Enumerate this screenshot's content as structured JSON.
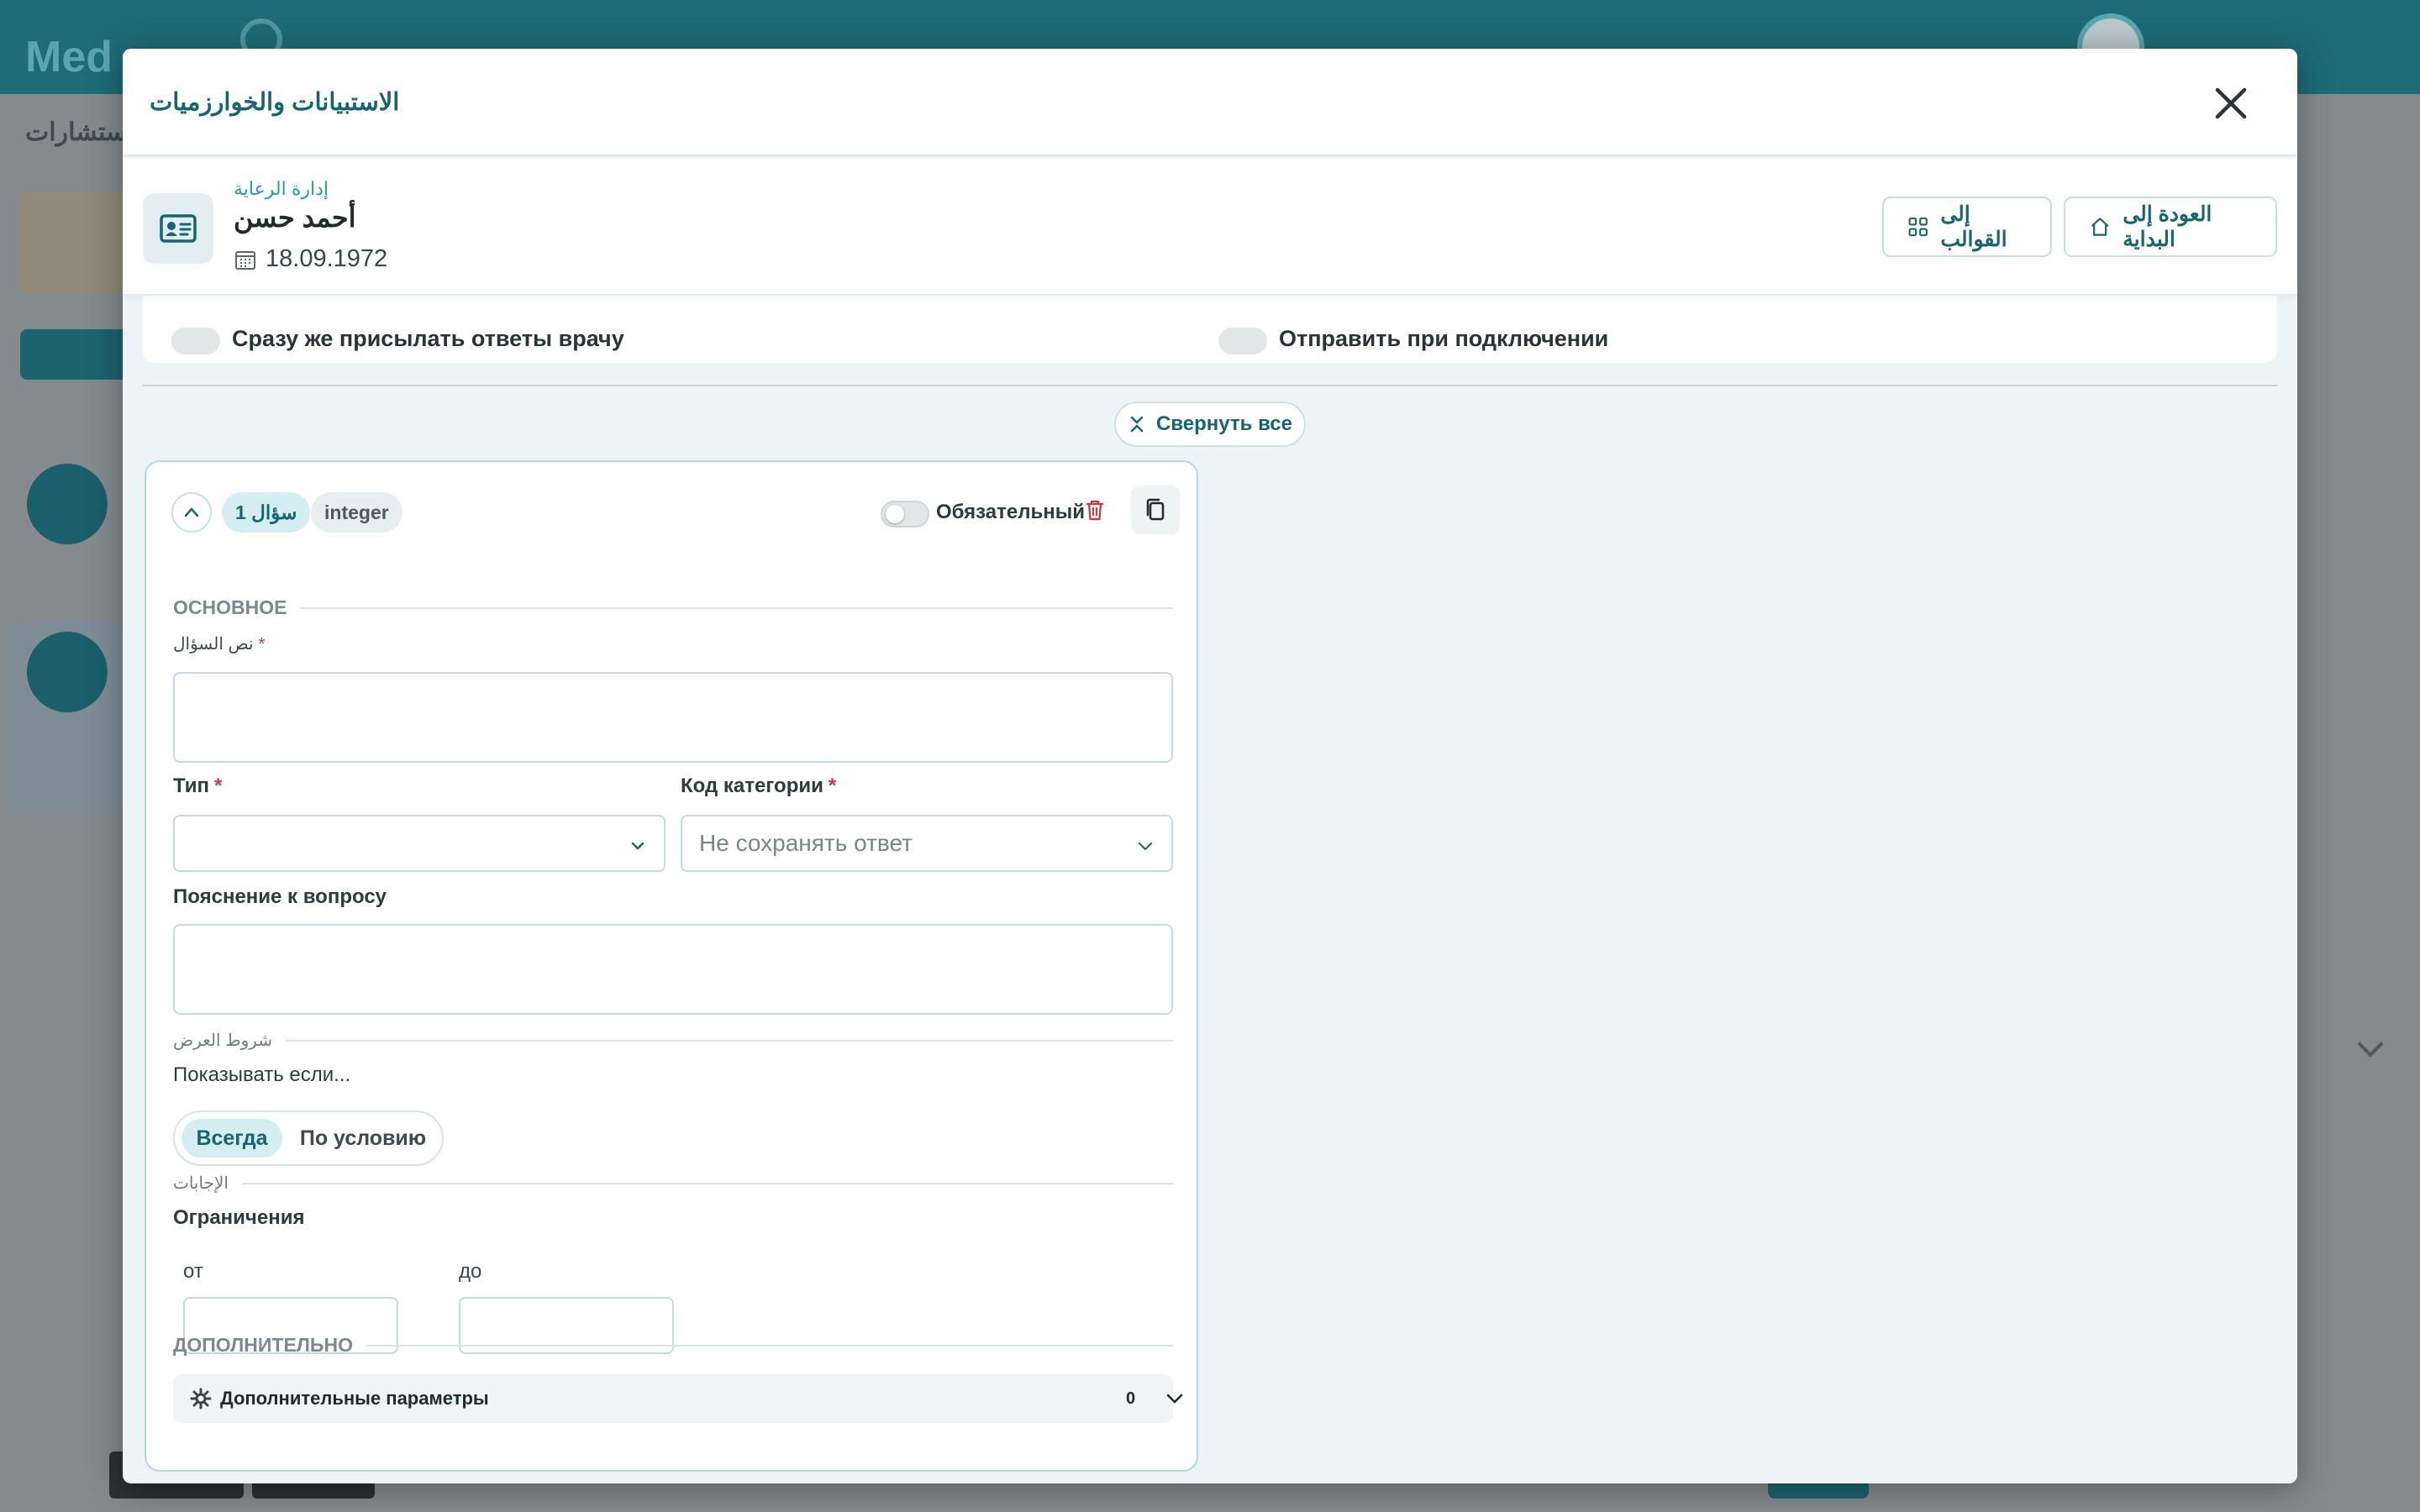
{
  "background": {
    "logo_text": "Med",
    "tab_text": "الاستشارات"
  },
  "modal": {
    "title": "الاستبيانات والخوارزميات",
    "close_icon": "close-icon"
  },
  "patient": {
    "department": "إدارة الرعاية",
    "name": "أحمد حسن",
    "dob": "18.09.1972"
  },
  "header_buttons": {
    "templates_label": "إلى القوالب",
    "home_label": "العودة إلى البداية"
  },
  "settings": {
    "send_immediately": "Сразу же присылать ответы врачу",
    "send_on_connect": "Отправить при подключении"
  },
  "collapse_all_label": "Свернуть все",
  "question": {
    "number_label": "سؤال 1",
    "type_badge": "integer",
    "required_label": "Обязательный",
    "required_on": false,
    "section_basic": "ОСНОВНОЕ",
    "question_text_label": "نص السؤال",
    "question_text_value": "",
    "type_label": "Тип",
    "type_value": "",
    "category_label": "Код категории",
    "category_placeholder": "Не сохранять ответ",
    "explanation_label": "Пояснение к вопросу",
    "explanation_value": "",
    "section_display": "شروط العرض",
    "show_if_label": "Показывать если...",
    "show_options": [
      "Всегда",
      "По условию"
    ],
    "show_selected": "Всегда",
    "section_answers": "الإجابات",
    "limits_label": "Ограничения",
    "from_label": "от",
    "to_label": "до",
    "from_value": "",
    "to_value": "",
    "section_additional": "ДОПОЛНИТЕЛЬНО",
    "extra_params_label": "Дополнительные параметры",
    "extra_params_count": "0"
  },
  "colors": {
    "brand": "#176573",
    "accent_light": "#d5eef1",
    "danger": "#d9343b"
  }
}
